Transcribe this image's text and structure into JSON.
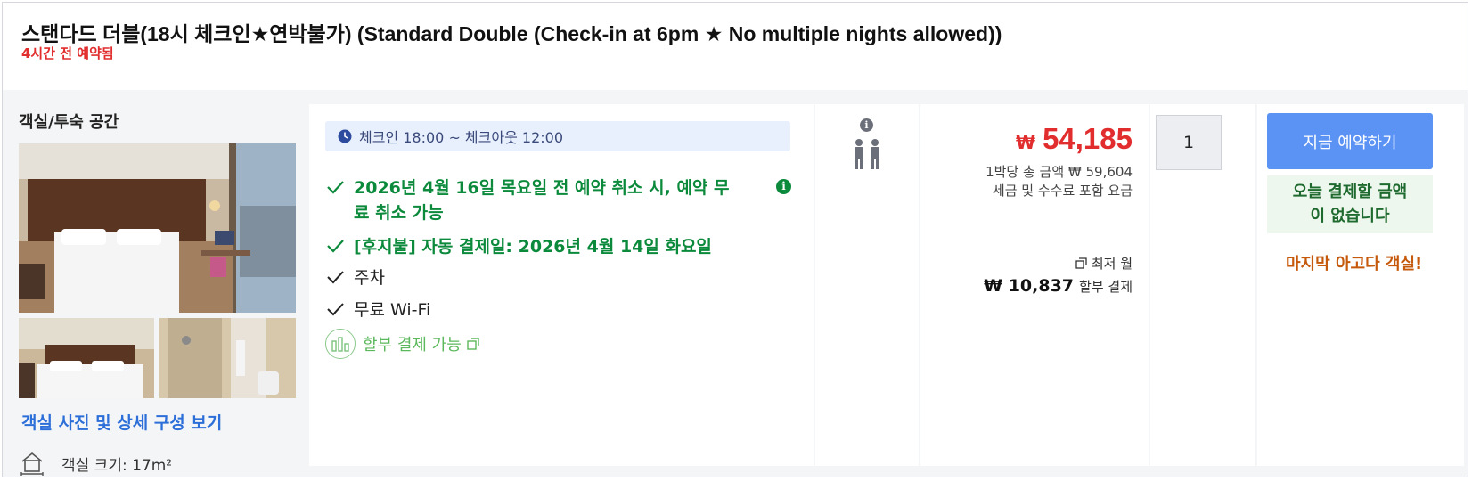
{
  "room": {
    "title": "스탠다드 더블(18시 체크인★연박불가) (Standard Double (Check-in at 6pm ★ No multiple nights allowed))",
    "booked_notice": "4시간 전 예약됨"
  },
  "left": {
    "section_label": "객실/투숙 공간",
    "photo_link": "객실 사진 및 상세 구성 보기",
    "room_size": "객실 크기: 17m²"
  },
  "features": {
    "checkin_checkout": "체크인 18:00 ~ 체크아웃 12:00",
    "free_cancel": "2026년 4월 16일 목요일 전 예약 취소 시, 예약 무료 취소 가능",
    "auto_pay": "[후지불] 자동 결제일: 2026년 4월 14일 화요일",
    "parking": "주차",
    "wifi": "무료 Wi-Fi",
    "installment": "할부 결제 가능"
  },
  "price": {
    "currency_symbol": "₩",
    "amount": "54,185",
    "per_night_total": "1박당 총 금액 ₩ 59,604",
    "tax_note": "세금 및 수수료 포함 요금",
    "lowest_monthly_label": "최저 월",
    "monthly_amount": "₩ 10,837",
    "monthly_suffix": "할부 결제"
  },
  "quantity": {
    "value": "1"
  },
  "booking": {
    "book_now_label": "지금 예약하기",
    "pay_today_line1": "오늘 결제할 금액",
    "pay_today_line2": "이 없습니다",
    "last_room": "마지막 아고다 객실!"
  },
  "icons": {
    "clock": "clock-icon",
    "check": "check-icon",
    "info": "info-icon",
    "occupancy": "two-adults-icon",
    "room_size": "room-size-icon",
    "external": "external-link-icon",
    "installment": "installment-icon"
  },
  "colors": {
    "accent_red": "#e12d2d",
    "accent_green": "#0c8a3c",
    "button_blue": "#5b93f5",
    "link_blue": "#2d6fd8",
    "warning_orange": "#c65a0c"
  }
}
